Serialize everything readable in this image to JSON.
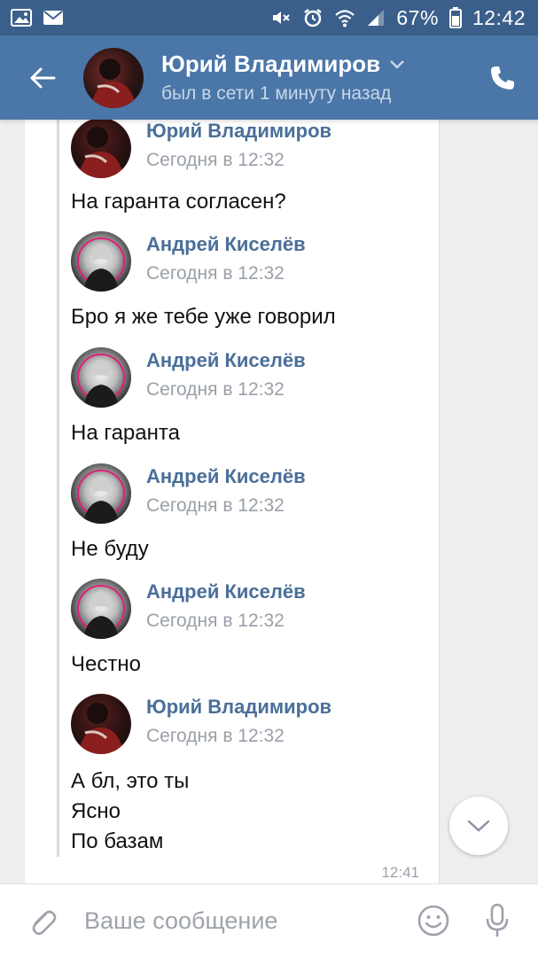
{
  "status_bar": {
    "battery": "67%",
    "time": "12:42"
  },
  "header": {
    "contact_name": "Юрий Владимиров",
    "last_seen": "был в сети 1 минуту назад"
  },
  "messages": [
    {
      "author": "Юрий Владимиров",
      "time": "Сегодня в 12:32",
      "text": "На гаранта согласен?",
      "avatar": "yuri"
    },
    {
      "author": "Андрей Киселёв",
      "time": "Сегодня в 12:32",
      "text": "Бро я же тебе уже говорил",
      "avatar": "andrey"
    },
    {
      "author": "Андрей Киселёв",
      "time": "Сегодня в 12:32",
      "text": "На гаранта",
      "avatar": "andrey"
    },
    {
      "author": "Андрей Киселёв",
      "time": "Сегодня в 12:32",
      "text": "Не буду",
      "avatar": "andrey"
    },
    {
      "author": "Андрей Киселёв",
      "time": "Сегодня в 12:32",
      "text": "Честно",
      "avatar": "andrey"
    },
    {
      "author": "Юрий Владимиров",
      "time": "Сегодня в 12:32",
      "text_lines": [
        "А бл, это ты",
        "Ясно",
        "По базам"
      ],
      "avatar": "yuri"
    }
  ],
  "message_time": "12:41",
  "composer": {
    "placeholder": "Ваше сообщение"
  }
}
